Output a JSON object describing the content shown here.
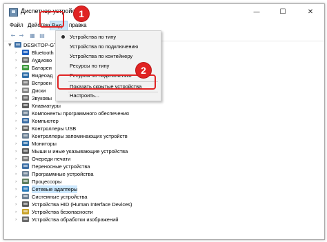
{
  "window": {
    "title": "Диспетчер устройств",
    "controls": {
      "minimize": "—",
      "maximize": "☐",
      "close": "✕"
    }
  },
  "menu": {
    "file": "Файл",
    "action": "Действие",
    "view": "Вид",
    "help_partial": "правка"
  },
  "toolbar": {
    "back": "←",
    "forward": "→",
    "b3": "▦",
    "b4": "▤"
  },
  "tree": {
    "root": "DESKTOP-GTI",
    "items": [
      {
        "label": "Bluetooth",
        "color": "#1f5fbf"
      },
      {
        "label": "Аудиово",
        "color": "#6b6b6b"
      },
      {
        "label": "Батареи",
        "color": "#3d9a3d"
      },
      {
        "label": "Видеоад",
        "color": "#2f6fa8"
      },
      {
        "label": "Встроен",
        "color": "#7a7a7a"
      },
      {
        "label": "Диски",
        "color": "#8a8a8a"
      },
      {
        "label": "Звуковы",
        "color": "#6b6b6b"
      },
      {
        "label": "Клавиатуры",
        "color": "#5a5a5a"
      },
      {
        "label": "Компоненты программного обеспечения",
        "color": "#6a7f93"
      },
      {
        "label": "Компьютер",
        "color": "#3b6ea5"
      },
      {
        "label": "Контроллеры USB",
        "color": "#6b6b6b"
      },
      {
        "label": "Контроллеры запоминающих устройств",
        "color": "#6a7f93"
      },
      {
        "label": "Мониторы",
        "color": "#2f6fa8"
      },
      {
        "label": "Мыши и иные указывающие устройства",
        "color": "#5a5a5a"
      },
      {
        "label": "Очереди печати",
        "color": "#7a7a7a"
      },
      {
        "label": "Переносные устройства",
        "color": "#3b6ea5"
      },
      {
        "label": "Программные устройства",
        "color": "#6a7f93"
      },
      {
        "label": "Процессоры",
        "color": "#5f7f5f"
      },
      {
        "label": "Сетевые адаптеры",
        "color": "#2a7ab8"
      },
      {
        "label": "Системные устройства",
        "color": "#6a7f93"
      },
      {
        "label": "Устройства HID (Human Interface Devices)",
        "color": "#5a5a5a"
      },
      {
        "label": "Устройства безопасности",
        "color": "#c9a227"
      },
      {
        "label": "Устройства обработки изображений",
        "color": "#6b6b6b"
      }
    ]
  },
  "view_menu": {
    "items": [
      "Устройства по типу",
      "Устройства по подключению",
      "Устройства по контейнеру",
      "Ресурсы по типу",
      "Ресурсы по подключению",
      "Показать скрытые устройства",
      "Настроить..."
    ]
  },
  "annotations": {
    "step1": "1",
    "step2": "2"
  },
  "colors": {
    "highlight": "#e02323",
    "menu_selected": "#cce4f7",
    "tree_selected": "#cce8ff"
  }
}
